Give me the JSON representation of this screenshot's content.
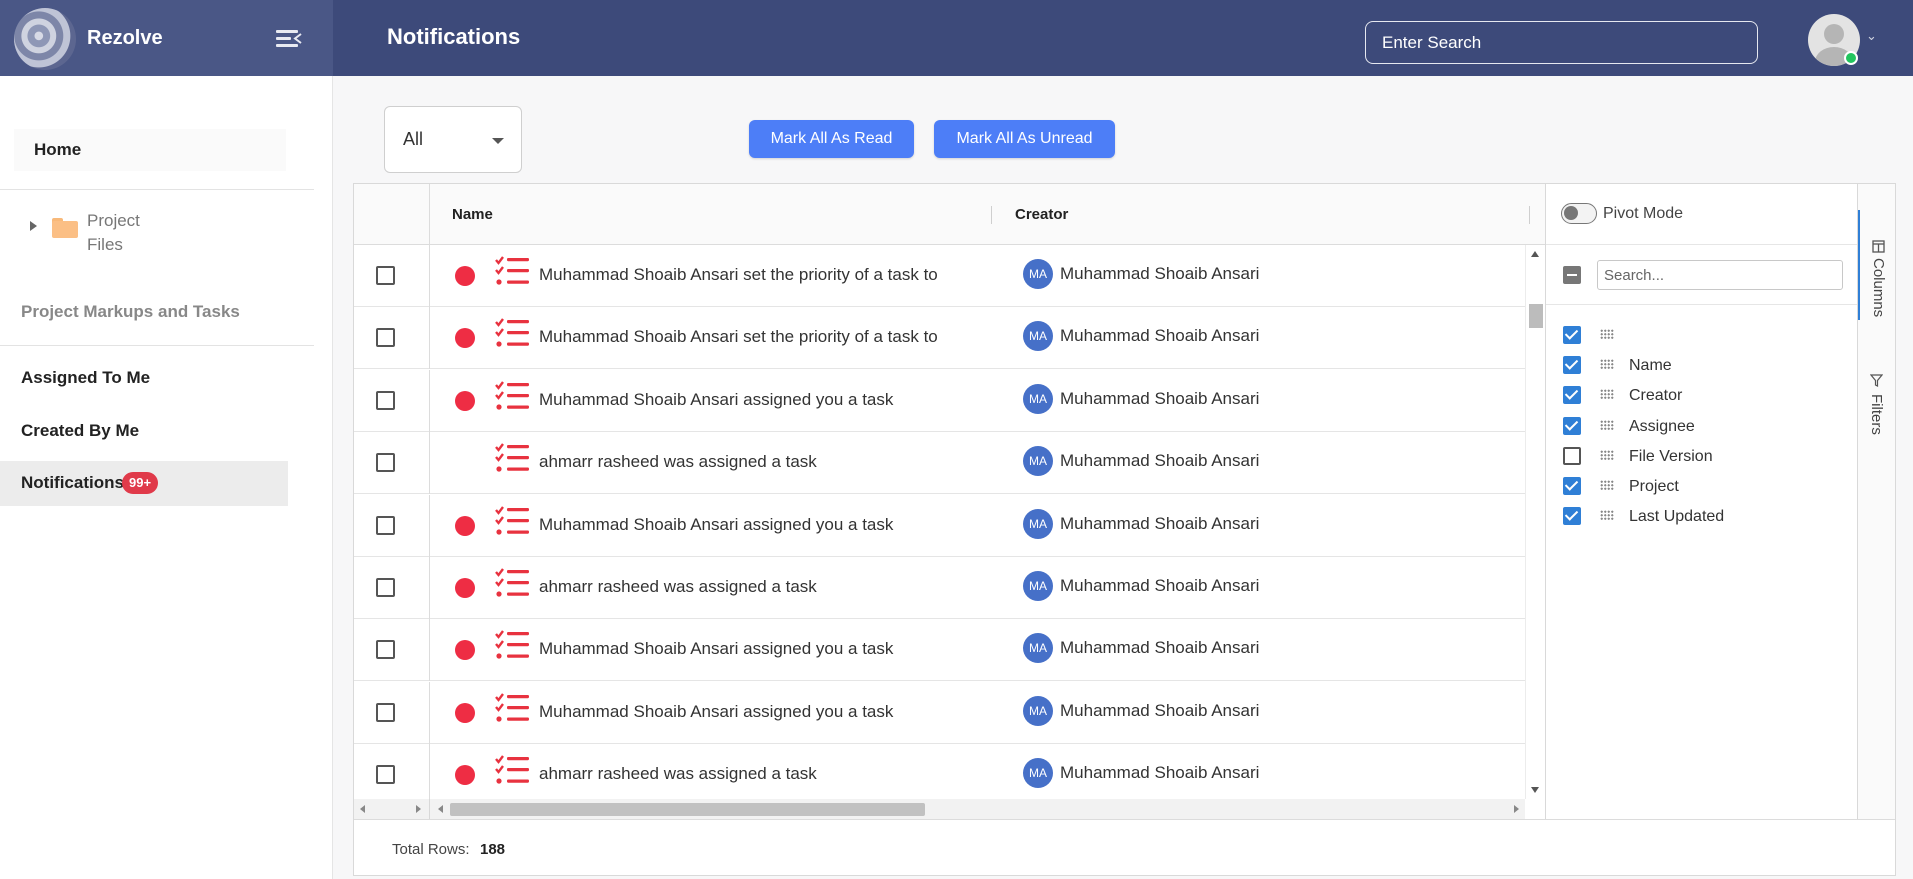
{
  "app": {
    "brand": "Rezolve",
    "page_title": "Notifications"
  },
  "search": {
    "placeholder": "Enter Search"
  },
  "sidebar": {
    "home": "Home",
    "tree_folder": "Project Files",
    "section_heading": "Project Markups and Tasks",
    "items": [
      "Assigned To Me",
      "Created By Me"
    ],
    "active_item": "Notifications",
    "badge": "99+"
  },
  "toolbar": {
    "filter_value": "All",
    "mark_read": "Mark All As Read",
    "mark_unread": "Mark All As Unread"
  },
  "grid": {
    "columns": {
      "name": "Name",
      "creator": "Creator"
    },
    "rows": [
      {
        "name": "Muhammad Shoaib Ansari set the priority of a task to",
        "creator": "Muhammad Shoaib Ansari",
        "initials": "MA",
        "unread": true
      },
      {
        "name": "Muhammad Shoaib Ansari set the priority of a task to",
        "creator": "Muhammad Shoaib Ansari",
        "initials": "MA",
        "unread": true
      },
      {
        "name": "Muhammad Shoaib Ansari assigned you a task",
        "creator": "Muhammad Shoaib Ansari",
        "initials": "MA",
        "unread": true
      },
      {
        "name": "ahmarr rasheed was assigned a task",
        "creator": "Muhammad Shoaib Ansari",
        "initials": "MA",
        "unread": false
      },
      {
        "name": "Muhammad Shoaib Ansari assigned you a task",
        "creator": "Muhammad Shoaib Ansari",
        "initials": "MA",
        "unread": true
      },
      {
        "name": "ahmarr rasheed was assigned a task",
        "creator": "Muhammad Shoaib Ansari",
        "initials": "MA",
        "unread": true
      },
      {
        "name": "Muhammad Shoaib Ansari assigned you a task",
        "creator": "Muhammad Shoaib Ansari",
        "initials": "MA",
        "unread": true
      },
      {
        "name": "Muhammad Shoaib Ansari assigned you a task",
        "creator": "Muhammad Shoaib Ansari",
        "initials": "MA",
        "unread": true
      },
      {
        "name": "ahmarr rasheed was assigned a task",
        "creator": "Muhammad Shoaib Ansari",
        "initials": "MA",
        "unread": true
      }
    ],
    "footer": {
      "label": "Total Rows:",
      "count": "188"
    }
  },
  "tool_panel": {
    "pivot_label": "Pivot Mode",
    "search_placeholder": "Search...",
    "columns": [
      {
        "label": "",
        "checked": true
      },
      {
        "label": "Name",
        "checked": true
      },
      {
        "label": "Creator",
        "checked": true
      },
      {
        "label": "Assignee",
        "checked": true
      },
      {
        "label": "File Version",
        "checked": false
      },
      {
        "label": "Project",
        "checked": true
      },
      {
        "label": "Last Updated",
        "checked": true
      }
    ],
    "tabs": {
      "columns": "Columns",
      "filters": "Filters"
    }
  },
  "colors": {
    "header": "#3d4a7a",
    "accent": "#4d7ef7",
    "unread_dot": "#ee2d44",
    "badge": "#e03a4a",
    "checkbox": "#2f7fd6"
  },
  "icons": [
    "logo-icon",
    "menu-collapse-icon",
    "avatar-icon",
    "folder-icon",
    "task-list-icon",
    "chevron-down-icon",
    "drag-handle-icon",
    "columns-icon",
    "filter-icon"
  ]
}
